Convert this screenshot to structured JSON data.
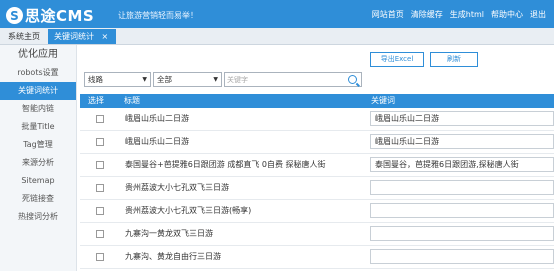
{
  "app": {
    "logo_mark": "S",
    "name": "思途CMS",
    "slogan": "让旅游营销轻而易举！"
  },
  "topnav": [
    "网站首页",
    "清除缓存",
    "生成html",
    "帮助中心",
    "退出"
  ],
  "tabs": [
    {
      "label": "系统主页"
    },
    {
      "label": "关键词统计",
      "close": "×"
    }
  ],
  "sidebar": {
    "heading": "优化应用",
    "items": [
      {
        "label": "robots设置"
      },
      {
        "label": "关键词统计"
      },
      {
        "label": "智能内链"
      },
      {
        "label": "批量Title"
      },
      {
        "label": "Tag管理"
      },
      {
        "label": "来源分析"
      },
      {
        "label": "Sitemap"
      },
      {
        "label": "死链接查"
      },
      {
        "label": "热搜词分析"
      }
    ]
  },
  "toolbar": {
    "export_label": "导出Excel",
    "refresh_label": "刷新"
  },
  "filters": {
    "type_value": "线路",
    "scope_value": "全部",
    "search_placeholder": "关键字"
  },
  "table": {
    "headers": {
      "select": "选择",
      "title": "标题",
      "keyword": "关键词"
    },
    "rows": [
      {
        "title": "峨眉山乐山二日游",
        "keyword": "峨眉山乐山二日游"
      },
      {
        "title": "峨眉山乐山二日游",
        "keyword": "峨眉山乐山二日游"
      },
      {
        "title": "泰国曼谷+芭提雅6日跟团游 成都直飞 0自费 探秘唐人街",
        "keyword": "泰国曼谷，芭提雅6日跟团游,探秘唐人街"
      },
      {
        "title": "贵州荔波大小七孔双飞三日游",
        "keyword": ""
      },
      {
        "title": "贵州荔波大小七孔双飞三日游(畅享)",
        "keyword": ""
      },
      {
        "title": "九寨沟一黄龙双飞三日游",
        "keyword": ""
      },
      {
        "title": "九寨沟、黄龙自由行三日游",
        "keyword": ""
      }
    ]
  }
}
